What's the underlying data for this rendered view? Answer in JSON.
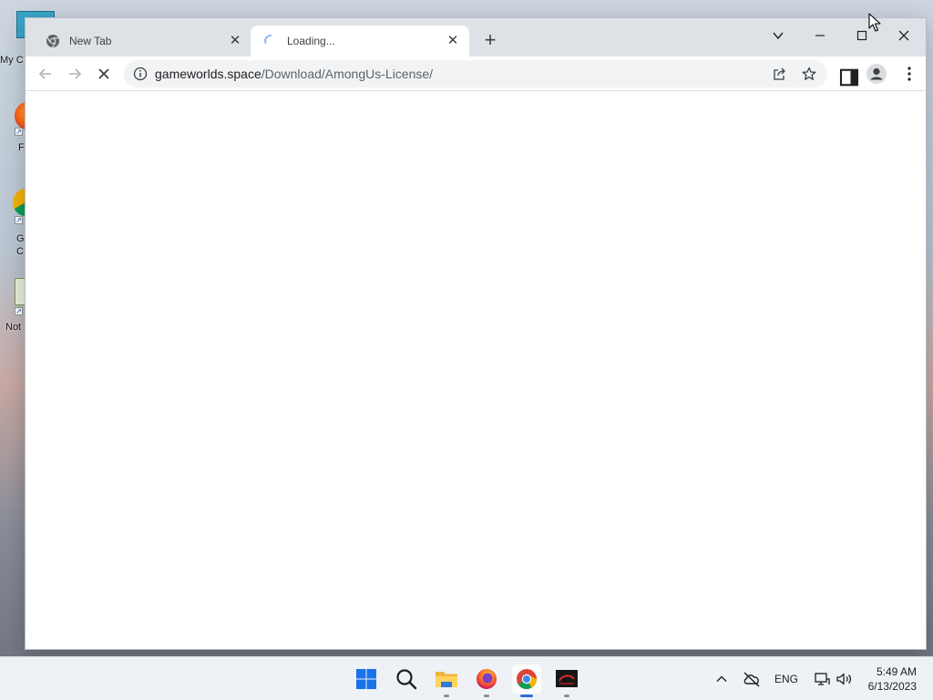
{
  "desktop": {
    "icons": [
      {
        "label": "My C",
        "name": "my-computer"
      },
      {
        "label": "F",
        "name": "firefox"
      },
      {
        "label": "G\nC",
        "name": "google-chrome"
      },
      {
        "label": "Not",
        "name": "notepad"
      }
    ]
  },
  "browser": {
    "tabs": [
      {
        "title": "New Tab",
        "active": false,
        "icon": "chrome-icon"
      },
      {
        "title": "Loading...",
        "active": true,
        "icon": "spinner-icon"
      }
    ],
    "address": {
      "host": "gameworlds.space",
      "path": "/Download/AmongUs-License/"
    },
    "nav": {
      "reload_state": "stop"
    }
  },
  "taskbar": {
    "apps": [
      "start-icon",
      "search-icon",
      "file-explorer-icon",
      "firefox-icon",
      "chrome-icon",
      "game-icon"
    ],
    "tray": {
      "language": "ENG"
    },
    "clock": {
      "time": "5:49 AM",
      "date": "6/13/2023"
    }
  },
  "colors": {
    "tabstrip": "#dee1e6",
    "accent": "#2f6fd6"
  }
}
